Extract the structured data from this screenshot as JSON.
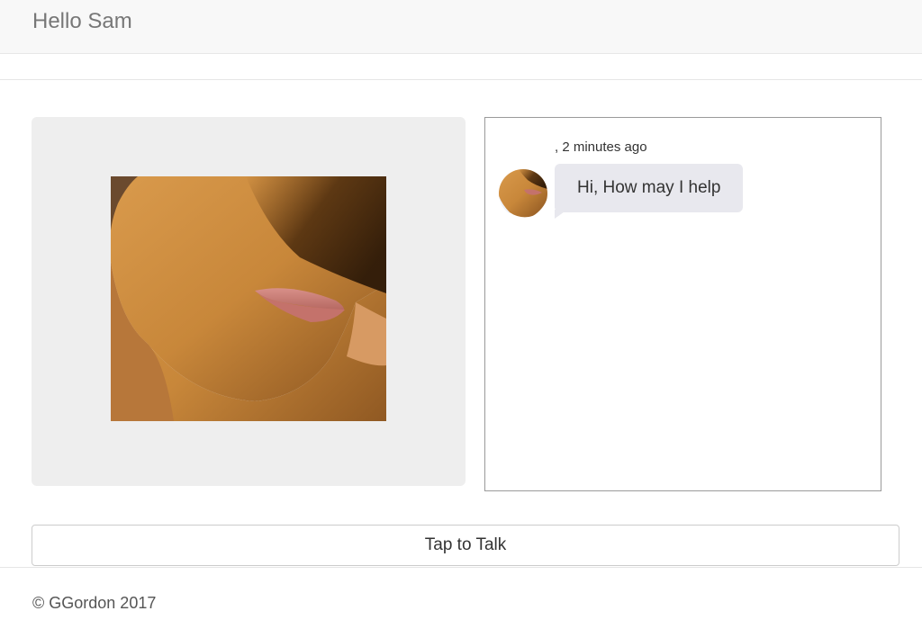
{
  "navbar": {
    "brand": "Hello Sam"
  },
  "avatar_panel": {
    "image_icon": "avatar-face-icon"
  },
  "chat": {
    "messages": [
      {
        "meta": ", 2 minutes ago",
        "text": "Hi, How may I help",
        "avatar_icon": "avatar-thumbnail-icon"
      }
    ]
  },
  "controls": {
    "talk_label": "Tap to Talk"
  },
  "footer": {
    "copyright": "© GGordon 2017"
  },
  "colors": {
    "navbar_bg": "#f8f8f8",
    "panel_bg": "#eeeeee",
    "bubble_bg": "#e8e8ee",
    "skin": "#c8873a",
    "lips": "#c97b75"
  }
}
